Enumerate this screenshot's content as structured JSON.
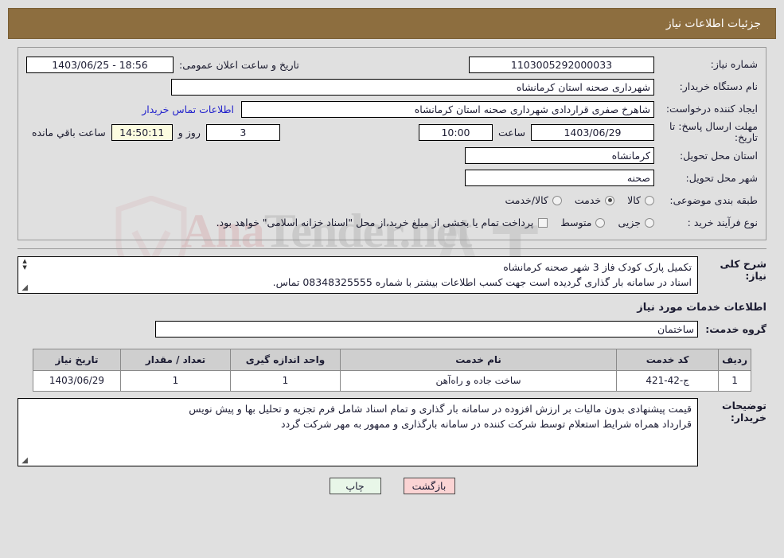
{
  "header": {
    "title": "جزئیات اطلاعات نیاز"
  },
  "info": {
    "need_number_label": "شماره نیاز:",
    "need_number_value": "1103005292000033",
    "announce_label": "تاریخ و ساعت اعلان عمومی:",
    "announce_value": "18:56 - 1403/06/25",
    "buyer_label": "نام دستگاه خریدار:",
    "buyer_value": "شهرداری صحنه استان کرمانشاه",
    "creator_label": "ایجاد کننده درخواست:",
    "creator_value": "شاهرخ صفری قراردادی شهرداری صحنه استان کرمانشاه",
    "contact_link": "اطلاعات تماس خریدار",
    "deadline_label": "مهلت ارسال پاسخ: تا تاریخ:",
    "deadline_date": "1403/06/29",
    "hour_label": "ساعت",
    "hour_value": "10:00",
    "days_value": "3",
    "days_label": "روز و",
    "remaining_value": "14:50:11",
    "remaining_label": "ساعت باقي مانده",
    "province_label": "استان محل تحویل:",
    "province_value": "کرمانشاه",
    "city_label": "شهر محل تحویل:",
    "city_value": "صحنه",
    "category_label": "طبقه بندی موضوعی:",
    "category_options": [
      {
        "label": "کالا",
        "selected": false
      },
      {
        "label": "خدمت",
        "selected": true
      },
      {
        "label": "کالا/خدمت",
        "selected": false
      }
    ],
    "process_label": "نوع فرآیند خرید :",
    "process_options": [
      {
        "label": "جزیی",
        "selected": false
      },
      {
        "label": "متوسط",
        "selected": false
      }
    ],
    "payment_checkbox_checked": false,
    "payment_note": "پرداخت تمام یا بخشی از مبلغ خرید،از محل \"اسناد خزانه اسلامی\" خواهد بود."
  },
  "description": {
    "label": "شرح کلی نیاز:",
    "line1": "تکمیل پارک  کودک  فاز 3 شهر صحنه کرمانشاه",
    "line2": "اسناد  در سامانه بار گذاری گردیده است جهت کسب اطلاعات بیشتر با شماره  08348325555 تماس."
  },
  "services": {
    "section_title": "اطلاعات خدمات مورد نیاز",
    "group_label": "گروه خدمت:",
    "group_value": "ساختمان",
    "table": {
      "headers": [
        "ردیف",
        "کد خدمت",
        "نام خدمت",
        "واحد اندازه گیری",
        "تعداد / مقدار",
        "تاریخ نیاز"
      ],
      "rows": [
        {
          "row_no": "1",
          "code": "ج-42-421",
          "name": "ساخت جاده و راه‌آهن",
          "unit": "1",
          "qty": "1",
          "need_date": "1403/06/29"
        }
      ]
    }
  },
  "buyer_notes": {
    "label": "توضیحات خریدار:",
    "line1": "قیمت پیشنهادی بدون مالیات بر ارزش افزوده در سامانه بار گذاری و تمام اسناد شامل فرم تجزیه و تحلیل بها و پیش نویس",
    "line2": "قرارداد همراه شرایط استعلام  توسط شرکت کننده در سامانه بارگذاری و ممهور به مهر شرکت گردد"
  },
  "footer": {
    "print_label": "چاپ",
    "back_label": "بازگشت"
  },
  "watermark": {
    "text_a": "Ana",
    "text_b": "Tender",
    "text_c": ".net"
  },
  "colors": {
    "header_bg": "#8d6e3f",
    "link": "#2222cc",
    "table_header_bg": "#cfcfcf",
    "back_btn_bg": "#fbd4d4",
    "print_btn_bg": "#e8f6e8",
    "countdown_bg": "#fcfce0"
  }
}
